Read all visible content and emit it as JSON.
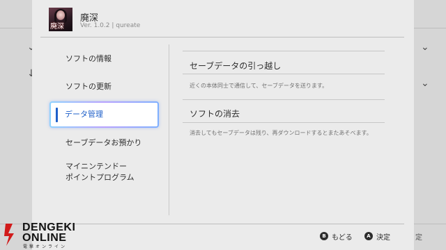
{
  "header": {
    "title": "廃深",
    "meta": "Ver. 1.0.2 | qureate",
    "icon_kanji": "廃深"
  },
  "menu": {
    "items": [
      {
        "label": "ソフトの情報"
      },
      {
        "label": "ソフトの更新"
      },
      {
        "label": "データ管理"
      },
      {
        "label": "セーブデータお預かり"
      },
      {
        "label_line1": "マイニンテンドー",
        "label_line2": "ポイントプログラム"
      }
    ],
    "selected_index": 2
  },
  "content": {
    "options": [
      {
        "title": "セーブデータの引っ越し",
        "desc": "近くの本体同士で通信して、セーブデータを送ります。"
      },
      {
        "title": "ソフトの消去",
        "desc": "消去してもセーブデータは残り、再ダウンロードするとまたあそべます。"
      }
    ]
  },
  "footer": {
    "back": {
      "button": "B",
      "label": "もどる"
    },
    "ok": {
      "button": "A",
      "label": "決定"
    },
    "partial": "定"
  },
  "watermark": {
    "line1": "DENGEKI",
    "line2": "ONLINE",
    "sub": "電撃オンライン"
  },
  "colors": {
    "accent": "#1f60c9",
    "panel": "#ebebeb",
    "watermark_red": "#d11a1a"
  }
}
